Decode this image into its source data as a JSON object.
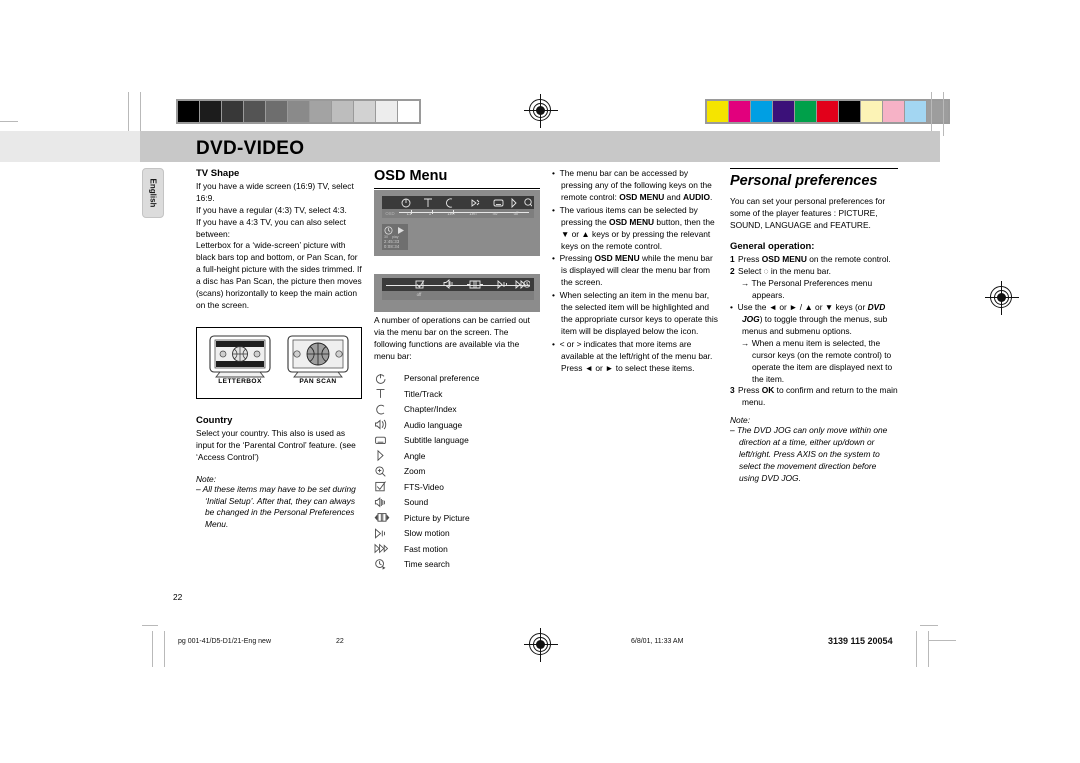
{
  "page": {
    "title": "DVD-VIDEO",
    "language_tab": "English",
    "page_number": "22"
  },
  "calibration": {
    "grayscale": [
      "#000000",
      "#1c1c1c",
      "#383838",
      "#545454",
      "#6e6e6e",
      "#8a8a8a",
      "#a3a3a3",
      "#bdbdbd",
      "#d2d2d2",
      "#ededed",
      "#ffffff"
    ],
    "color": [
      "#f5e400",
      "#e2007d",
      "#009fe3",
      "#3b1179",
      "#00a04a",
      "#e2001a",
      "#000000",
      "#fcf3b6",
      "#f6b2c6",
      "#a3d6f2",
      "#9d9d9d"
    ]
  },
  "col1": {
    "tv_shape_heading": "TV Shape",
    "tv_shape_p1": "If you have a wide screen (16:9) TV, select 16:9.",
    "tv_shape_p2": "If you have a regular (4:3) TV, select 4:3.",
    "tv_shape_p3": "If you have a 4:3 TV, you can also select between:",
    "tv_shape_p4": "Letterbox for a ‘wide-screen’ picture with black bars top and bottom, or Pan Scan, for a full-height picture with the sides trimmed. If a disc has Pan Scan, the picture then moves (scans) horizontally to keep the main action on the screen.",
    "figure": {
      "letterbox_caption": "LETTERBOX",
      "panscan_caption": "PAN SCAN"
    },
    "country_heading": "Country",
    "country_p1": "Select your country. This also is used as input for the ‘Parental Control’ feature. (see ‘Access Control’)",
    "note_label": "Note:",
    "note_item": "–  All these items may have to be set during ‘Initial Setup’.  After that, they can always be changed in the Personal Preferences Menu."
  },
  "col2": {
    "section_heading": "OSD Menu",
    "osd_screen_1": {
      "menu_values": [
        "L1",
        "1",
        "1en",
        "1en",
        "no",
        "off"
      ],
      "status_left": "OSD",
      "counter_total": "2:45:33",
      "counter_elapsed": "0:08:34",
      "icon_names": [
        "personal-preference-icon",
        "title-track-icon",
        "chapter-index-icon",
        "audio-language-icon",
        "subtitle-language-icon",
        "angle-icon",
        "zoom-icon"
      ]
    },
    "osd_screen_2": {
      "menu_values": [
        "off"
      ],
      "icon_names": [
        "fts-video-icon",
        "sound-icon",
        "picture-by-picture-icon",
        "slow-motion-icon",
        "fast-motion-icon",
        "time-search-icon"
      ]
    },
    "intro_p": "A number of operations can be carried out via the menu bar on the screen. The following functions are available via the menu bar:",
    "functions": [
      {
        "icon": "personal-preference-icon",
        "label": "Personal preference"
      },
      {
        "icon": "title-track-icon",
        "label": "Title/Track"
      },
      {
        "icon": "chapter-index-icon",
        "label": "Chapter/Index"
      },
      {
        "icon": "audio-language-icon",
        "label": "Audio language"
      },
      {
        "icon": "subtitle-language-icon",
        "label": "Subtitle language"
      },
      {
        "icon": "angle-icon",
        "label": "Angle"
      },
      {
        "icon": "zoom-icon",
        "label": "Zoom"
      },
      {
        "icon": "fts-video-icon",
        "label": "FTS-Video"
      },
      {
        "icon": "sound-icon",
        "label": "Sound"
      },
      {
        "icon": "picture-by-picture-icon",
        "label": "Picture by Picture"
      },
      {
        "icon": "slow-motion-icon",
        "label": "Slow motion"
      },
      {
        "icon": "fast-motion-icon",
        "label": "Fast motion"
      },
      {
        "icon": "time-search-icon",
        "label": "Time search"
      }
    ]
  },
  "col3": {
    "bullets": [
      "The menu bar can be accessed by pressing any of the following keys on the remote control: OSD MENU and AUDIO.",
      "The various items can be selected by pressing the OSD MENU button, then the ▼ or ▲ keys or by pressing the relevant keys on the remote control.",
      "Pressing OSD MENU while the menu bar is displayed will clear the menu bar from the screen.",
      "When selecting an item in the menu bar, the selected item will be highlighted and the appropriate cursor keys to operate this item will be displayed below the icon.",
      "< or > indicates that more items are available at the left/right of the menu bar. Press ◄ or ► to select these items."
    ]
  },
  "col4": {
    "section_heading": "Personal preferences",
    "intro": "You can set your personal preferences for some of the player features : PICTURE, SOUND, LANGUAGE and FEATURE.",
    "general_heading": "General operation:",
    "step1_num": "1",
    "step1": "Press OSD MENU on the remote control.",
    "step2_num": "2",
    "step2": "Select ◌ in the menu bar.",
    "step2_arrow": "→ The Personal Preferences menu appears.",
    "bullet1": "Use the ◄ or ► / ▲ or ▼ keys (or DVD JOG) to toggle through the menus, sub menus and submenu options.",
    "bullet1_arrow": "→ When a menu item is selected, the cursor keys (on the remote control) to operate the item are displayed next to the item.",
    "step3_num": "3",
    "step3": "Press OK to confirm and return to the main menu.",
    "note_label": "Note:",
    "note_item": "–  The DVD JOG can only move within one direction at a time, either up/down or left/right.  Press AXIS on the system to select the movement direction before using DVD JOG."
  },
  "footer": {
    "filename": "pg 001-41/D5-D1/21-Eng new",
    "page": "22",
    "timestamp": "6/8/01, 11:33 AM",
    "doc_code": "3139 115 20054"
  }
}
